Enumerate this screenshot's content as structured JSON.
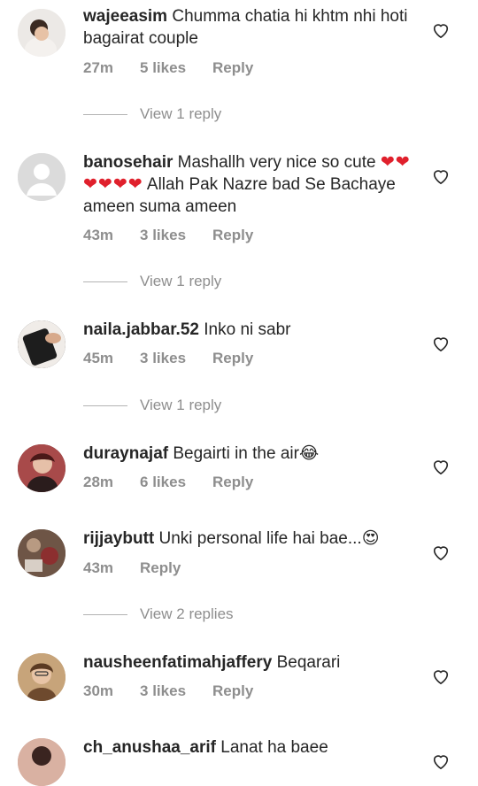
{
  "comments": [
    {
      "username": "wajeeasim",
      "text": "Chumma chatia hi khtm nhi hoti bagairat couple",
      "time": "27m",
      "likes": "5 likes",
      "reply": "Reply"
    },
    {
      "username": "banosehair",
      "text": "Mashallh very nice so cute ",
      "emoji": "❤❤❤❤❤❤",
      "text2": " Allah Pak Nazre bad Se Bachaye ameen suma ameen",
      "time": "43m",
      "likes": "3 likes",
      "reply": "Reply"
    },
    {
      "username": "naila.jabbar.52",
      "text": "Inko ni sabr",
      "time": "45m",
      "likes": "3 likes",
      "reply": "Reply"
    },
    {
      "username": "duraynajaf",
      "text": "Begairti in the air",
      "emoji": "😂",
      "time": "28m",
      "likes": "6 likes",
      "reply": "Reply"
    },
    {
      "username": "rijjaybutt",
      "text": "Unki personal life hai bae...",
      "emoji": "😍",
      "time": "43m",
      "reply": "Reply"
    },
    {
      "username": "nausheenfatimahjaffery",
      "text": "Beqarari",
      "time": "30m",
      "likes": "3 likes",
      "reply": "Reply"
    },
    {
      "username": "ch_anushaa_arif",
      "text": "Lanat ha baee"
    }
  ],
  "view_replies": [
    "View 1 reply",
    "View 1 reply",
    "View 1 reply",
    "View 2 replies"
  ],
  "colors": {
    "text": "#262626",
    "muted": "#8e8e8e",
    "heart": "#e0202c"
  }
}
